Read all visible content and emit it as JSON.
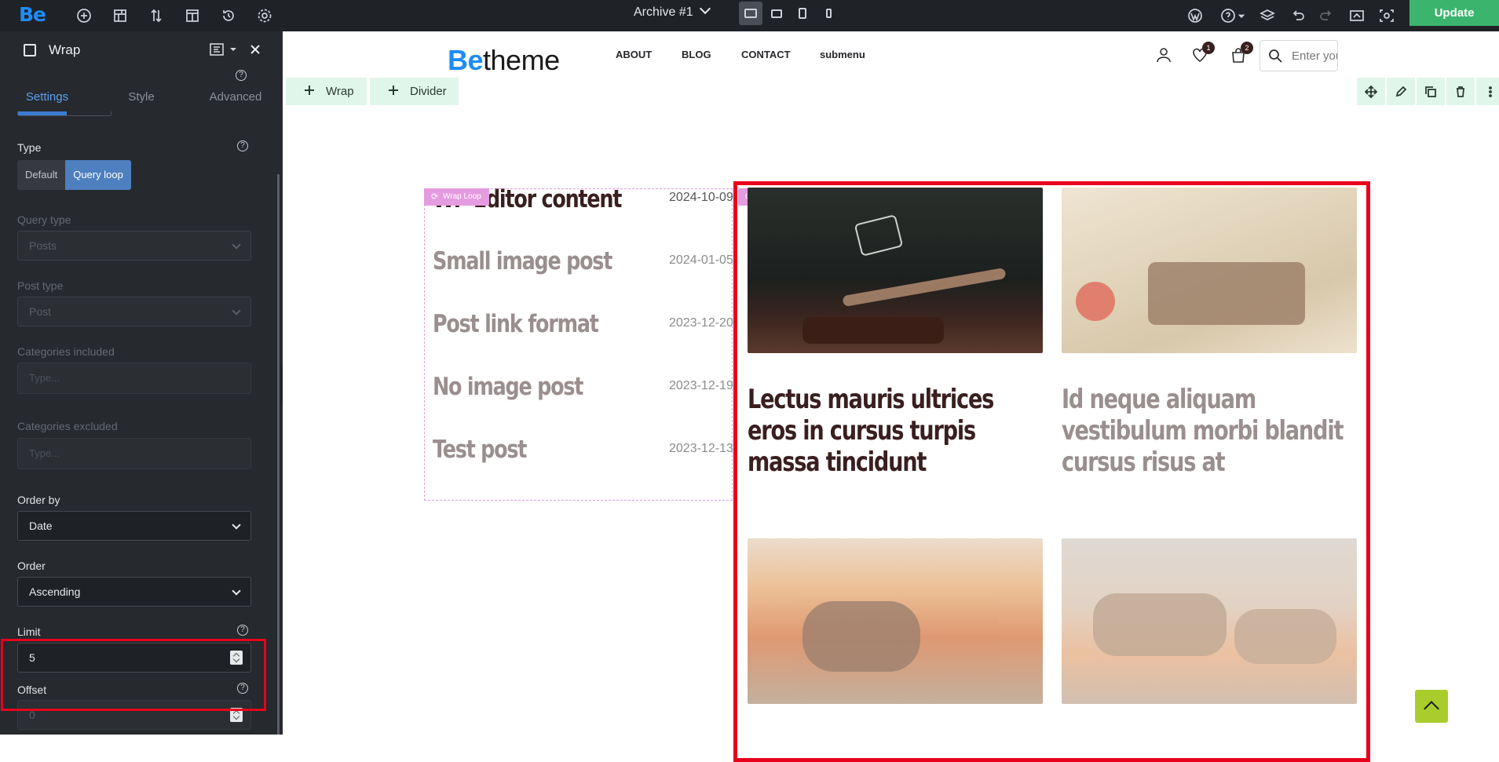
{
  "topbar": {
    "logo": "Be",
    "doc_title": "Archive #1",
    "update_label": "Update",
    "icons": [
      "add-icon",
      "layout-icon",
      "sort-icon",
      "template-icon",
      "history-icon",
      "settings-icon"
    ],
    "devices": [
      "desktop",
      "tablet-landscape",
      "tablet-portrait",
      "mobile"
    ],
    "active_device": "desktop",
    "right_icons": [
      "wordpress-icon",
      "help-icon",
      "layers-icon",
      "undo-icon",
      "redo-icon",
      "preview-icon",
      "live-preview-icon"
    ]
  },
  "panel": {
    "title": "Wrap",
    "tabs": [
      "Settings",
      "Style",
      "Advanced"
    ],
    "active_tab": "Settings",
    "type_label": "Type",
    "type_options": [
      "Default",
      "Query loop"
    ],
    "type_selected": "Query loop",
    "query_type_label": "Query type",
    "query_type_value": "Posts",
    "post_type_label": "Post type",
    "post_type_value": "Post",
    "cats_included_label": "Categories included",
    "cats_included_placeholder": "Type...",
    "cats_excluded_label": "Categories excluded",
    "cats_excluded_placeholder": "Type...",
    "order_by_label": "Order by",
    "order_by_value": "Date",
    "order_label": "Order",
    "order_value": "Ascending",
    "limit_label": "Limit",
    "limit_value": "5",
    "offset_label": "Offset",
    "offset_value": "0",
    "help_glyph": "?"
  },
  "site": {
    "logo_be": "Be",
    "logo_theme": "theme",
    "nav": [
      "ABOUT",
      "BLOG",
      "CONTACT",
      "submenu"
    ],
    "wishlist_count": "1",
    "cart_count": "2",
    "search_placeholder": "Enter your search"
  },
  "builder": {
    "add_wrap": "Wrap",
    "add_divider": "Divider",
    "wrap_loop_tag": "Wrap Loop"
  },
  "posts_list": [
    {
      "title": "WP Editor content",
      "date": "2024-10-09"
    },
    {
      "title": "Small image post",
      "date": "2024-01-05"
    },
    {
      "title": "Post link format",
      "date": "2023-12-20"
    },
    {
      "title": "No image post",
      "date": "2023-12-19"
    },
    {
      "title": "Test post",
      "date": "2023-12-13"
    }
  ],
  "cards": [
    {
      "title": "Lectus mauris ultrices eros in cursus turpis massa tincidunt"
    },
    {
      "title": "Id neque aliquam vestibulum morbi blandit cursus risus at"
    }
  ],
  "colors": {
    "accent": "#1d8cf8",
    "update": "#3bb46e",
    "highlight": "#e8001c",
    "wrap_loop": "#e59be0",
    "post_dark": "#3a1f1f"
  }
}
